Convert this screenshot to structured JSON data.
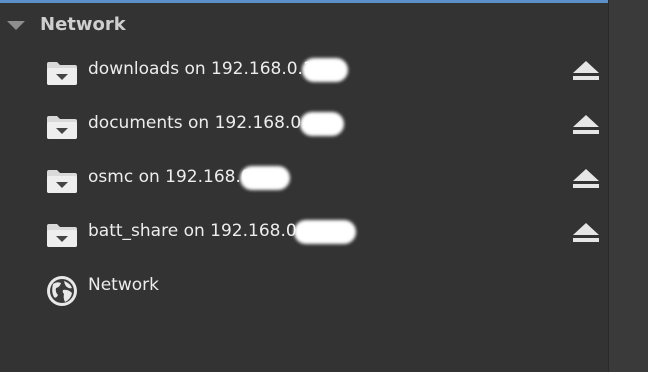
{
  "section": {
    "title": "Network"
  },
  "rows": [
    {
      "label": "downloads on 192.168.0.1",
      "icon": "folder-icon",
      "action_icon": "eject-icon"
    },
    {
      "label": "documents on 192.168.0.1",
      "icon": "folder-icon",
      "action_icon": "eject-icon"
    },
    {
      "label": "osmc on 192.168.0.",
      "icon": "folder-icon",
      "action_icon": "eject-icon"
    },
    {
      "label": "batt_share on 192.168.0.",
      "icon": "folder-icon",
      "action_icon": "eject-icon"
    }
  ],
  "network_item": {
    "label": "Network",
    "icon": "globe-icon"
  },
  "colors": {
    "panel_bg": "#333333",
    "accent": "#5b8fc8",
    "text": "#ededed"
  }
}
